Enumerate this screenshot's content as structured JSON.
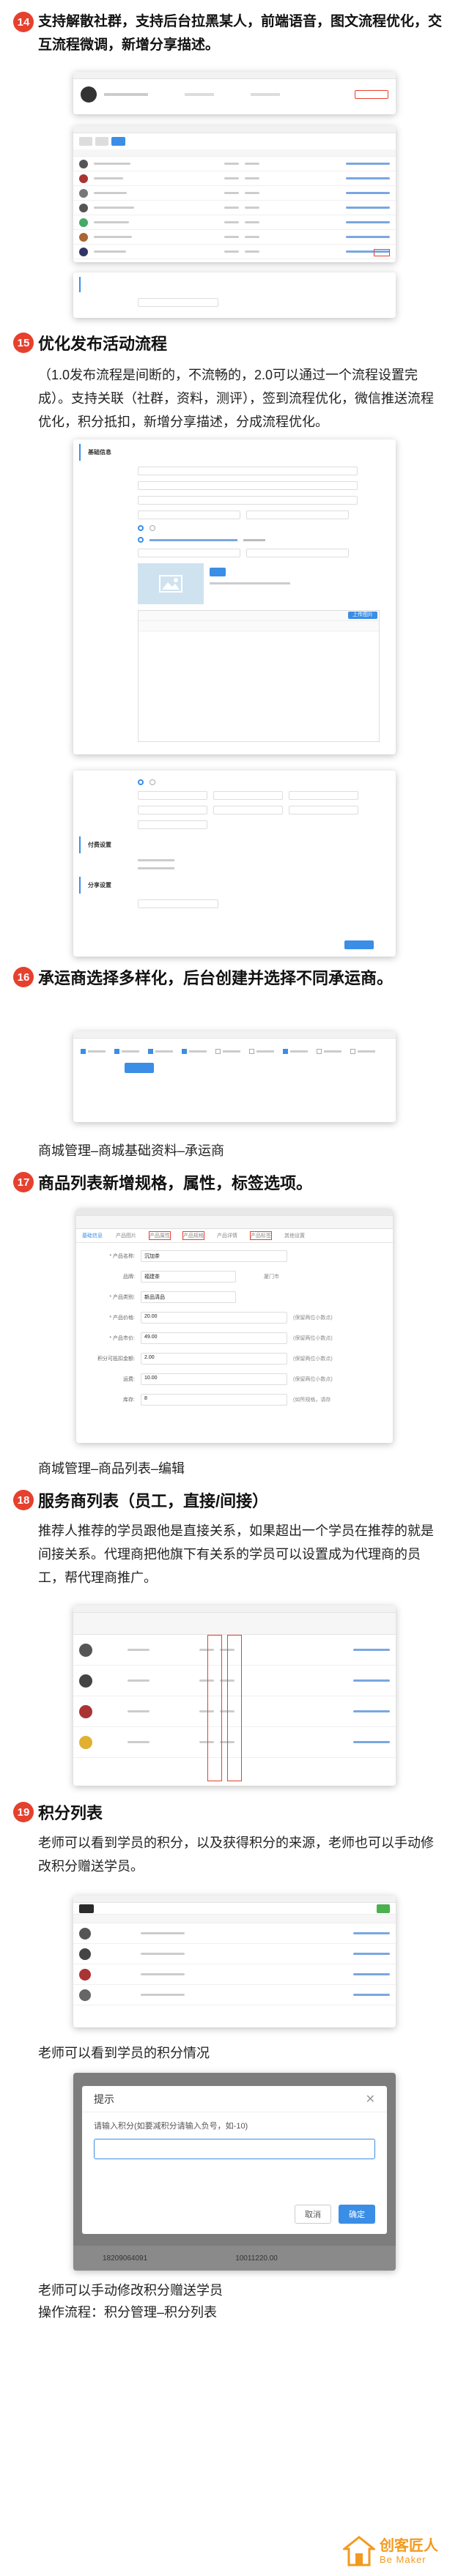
{
  "sections": [
    {
      "num": "14",
      "title": "支持解散社群，支持后台拉黑某人，前端语音，图文流程优化，交互流程微调，新增分享描述。"
    },
    {
      "num": "15",
      "title": "优化发布活动流程",
      "desc": "（1.0发布流程是间断的，不流畅的，2.0可以通过一个流程设置完成）。支持关联（社群，资料，测评），签到流程优化，微信推送流程优化，积分抵扣，新增分享描述，分成流程优化。"
    },
    {
      "num": "16",
      "title": "承运商选择多样化，后台创建并选择不同承运商。",
      "caption": "商城管理–商城基础资料–承运商"
    },
    {
      "num": "17",
      "title": "商品列表新增规格，属性，标签选项。",
      "caption": "商城管理–商品列表–编辑"
    },
    {
      "num": "18",
      "title": "服务商列表（员工，直接/间接）",
      "desc": "推荐人推荐的学员跟他是直接关系，如果超出一个学员在推荐的就是间接关系。代理商把他旗下有关系的学员可以设置成为代理商的员工，帮代理商推广。"
    },
    {
      "num": "19",
      "title": "积分列表",
      "desc": "老师可以看到学员的积分，以及获得积分的来源，老师也可以手动修改积分赠送学员。",
      "caption": "老师可以看到学员的积分情况"
    }
  ],
  "final_caption_1": "老师可以手动修改积分赠送学员",
  "final_caption_2": "操作流程：积分管理–积分列表",
  "shot15": {
    "section_title": "基础信息",
    "upload_btn": "上传图片",
    "section2_title": "付费设置",
    "section3_title": "分享设置"
  },
  "shot17": {
    "tabs": [
      "基础信息",
      "产品图片",
      "产品属性",
      "产品规格",
      "产品详情",
      "产品标签",
      "其他设置"
    ],
    "rows": [
      {
        "label": "* 产品名称:",
        "value": "沉加茶"
      },
      {
        "label": "品牌:",
        "value": "福建茶"
      },
      {
        "label": "产地:",
        "value": "厦门市"
      },
      {
        "label": "* 产品类别:",
        "value": "新品清品"
      },
      {
        "label": "* 产品价格:",
        "value": "20.00",
        "hint": "(保留两位小数点)"
      },
      {
        "label": "* 产品市价:",
        "value": "49.00",
        "hint": "(保留两位小数点)"
      },
      {
        "label": "积分可抵扣金额:",
        "value": "2.00",
        "hint": "(保留两位小数点)"
      },
      {
        "label": "运费:",
        "value": "10.00",
        "hint": "(保留两位小数点)"
      },
      {
        "label": "库存:",
        "value": "8",
        "hint": "(如所规格，请存"
      }
    ]
  },
  "dialog": {
    "title": "提示",
    "message": "请输入积分(如要减积分请输入负号，如-10)",
    "cancel": "取消",
    "confirm": "确定",
    "row_left": "18209064091",
    "row_right": "10011220.00"
  },
  "logo": {
    "cn": "创客匠人",
    "en": "Be  Maker"
  },
  "colors": {
    "accent": "#e6402e",
    "blue": "#3a8ee6",
    "logo": "#f39a1e"
  }
}
